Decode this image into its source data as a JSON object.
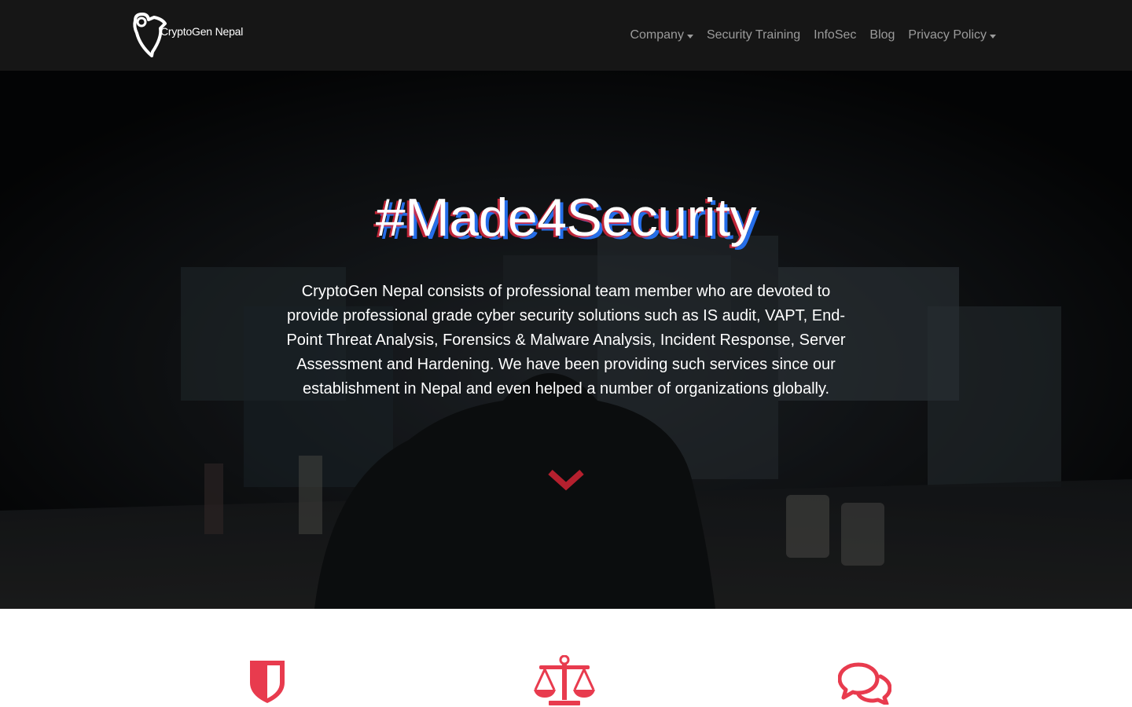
{
  "brand": {
    "name": "CryptoGen Nepal",
    "logo_icon": "shield-key-logo-icon"
  },
  "nav": {
    "items": [
      {
        "label": "Company",
        "dropdown": true
      },
      {
        "label": "Security Training",
        "dropdown": false
      },
      {
        "label": "InfoSec",
        "dropdown": false
      },
      {
        "label": "Blog",
        "dropdown": false
      },
      {
        "label": "Privacy Policy",
        "dropdown": true
      }
    ]
  },
  "hero": {
    "title": "#Made4Security",
    "description": "CryptoGen Nepal consists of professional team member who are devoted to provide professional grade cyber security solutions such as IS audit, VAPT, End-Point Threat Analysis, Forensics & Malware Analysis, Incident Response, Server Assessment and Hardening. We have been providing such services since our establishment in Nepal and even helped a number of organizations globally.",
    "scroll_icon": "chevron-down-icon"
  },
  "features": {
    "icons": [
      "shield-icon",
      "balance-scale-icon",
      "comments-icon"
    ]
  },
  "colors": {
    "navbar_bg": "#161616",
    "nav_text": "#9b9b9b",
    "accent": "#e83b4e",
    "accent_dark": "#b5202e"
  }
}
